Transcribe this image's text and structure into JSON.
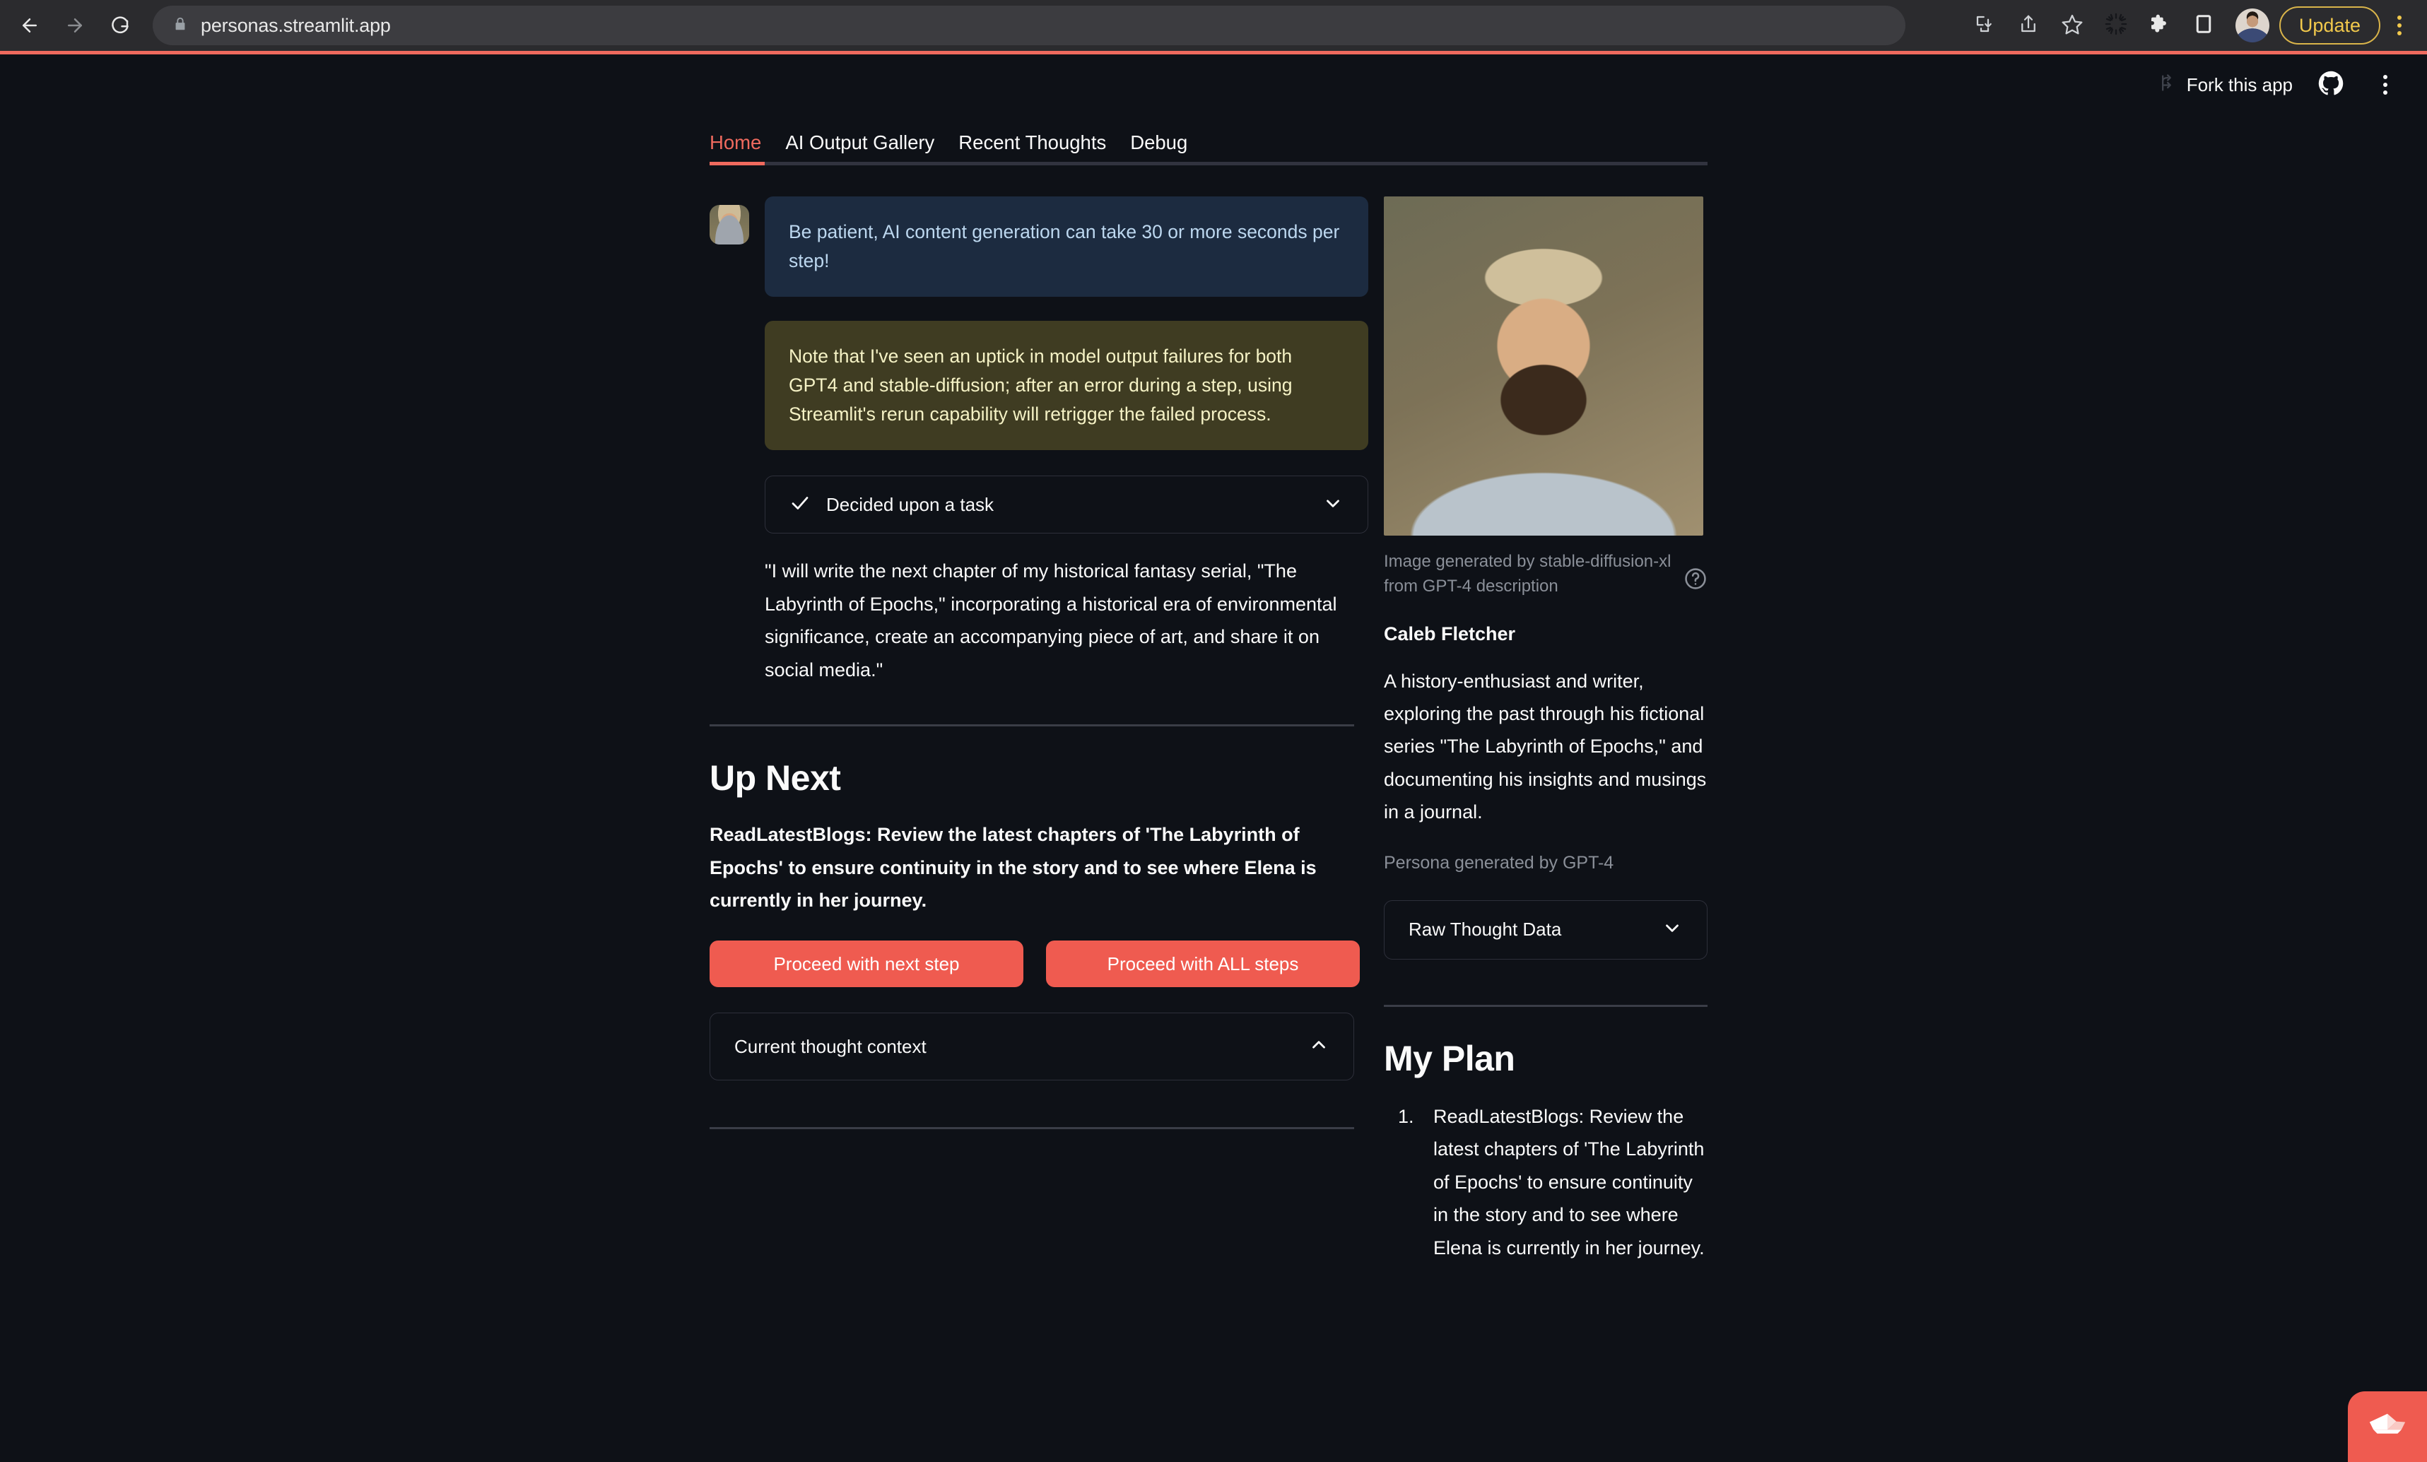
{
  "browser": {
    "url": "personas.streamlit.app",
    "update_label": "Update",
    "icons": {
      "back": "back-arrow-icon",
      "forward": "forward-arrow-icon",
      "reload": "reload-icon",
      "lock": "lock-icon",
      "install": "install-app-icon",
      "share": "share-icon",
      "bookmark": "star-icon",
      "loading": "loading-spinner-icon",
      "extensions": "puzzle-extension-icon",
      "sidepanel": "side-panel-icon",
      "profile": "profile-avatar-icon",
      "menu": "kebab-menu-icon"
    }
  },
  "st_header": {
    "fork_label": "Fork this app",
    "github_icon": "github-icon",
    "menu_icon": "kebab-menu-icon"
  },
  "tabs": [
    {
      "label": "Home",
      "active": true
    },
    {
      "label": "AI Output Gallery",
      "active": false
    },
    {
      "label": "Recent Thoughts",
      "active": false
    },
    {
      "label": "Debug",
      "active": false
    }
  ],
  "left": {
    "info_alert": "Be patient, AI content generation can take 30 or more seconds per step!",
    "warning_alert": "Note that I've seen an uptick in model output failures for both GPT4 and stable-diffusion; after an error during a step, using Streamlit's rerun capability will retrigger the failed process.",
    "decided_expander": {
      "label": "Decided upon a task",
      "check_icon": "check-icon",
      "chevron": "chevron-down-icon"
    },
    "task_quote": "\"I will write the next chapter of my historical fantasy serial, \"The Labyrinth of Epochs,\" incorporating a historical era of environmental significance, create an accompanying piece of art, and share it on social media.\"",
    "up_next_title": "Up Next",
    "up_next_description": "ReadLatestBlogs: Review the latest chapters of 'The Labyrinth of Epochs' to ensure continuity in the story and to see where Elena is currently in her journey.",
    "button_next_step": "Proceed with next step",
    "button_all_steps": "Proceed with ALL steps",
    "context_expander": {
      "label": "Current thought context",
      "chevron": "chevron-up-icon"
    }
  },
  "right": {
    "image_alt": "persona-portrait",
    "image_caption": "Image generated by stable-diffusion-xl from GPT-4 description",
    "help_icon": "help-circle-icon",
    "persona_name": "Caleb Fletcher",
    "persona_description": "A history-enthusiast and writer, exploring the past through his fictional series \"The Labyrinth of Epochs,\" and documenting his insights and musings in a journal.",
    "persona_source": "Persona generated by GPT-4",
    "raw_thought_expander": {
      "label": "Raw Thought Data",
      "chevron": "chevron-down-icon"
    },
    "plan_title": "My Plan",
    "plan_items": [
      "ReadLatestBlogs: Review the latest chapters of 'The Labyrinth of Epochs' to ensure continuity in the story and to see where Elena is currently in her journey."
    ]
  },
  "badge": {
    "icon": "streamlit-boat-icon"
  },
  "colors": {
    "page_bg": "#0e1117",
    "accent_red": "#ef5b50",
    "tab_active": "#ef6a5e",
    "info_bg": "#1c2b40",
    "info_text": "#bcd7ef",
    "warn_bg": "#3f3c22",
    "warn_text": "#f5f2c5",
    "muted_text": "#8a8f98",
    "update_yellow": "#f2c94c"
  }
}
